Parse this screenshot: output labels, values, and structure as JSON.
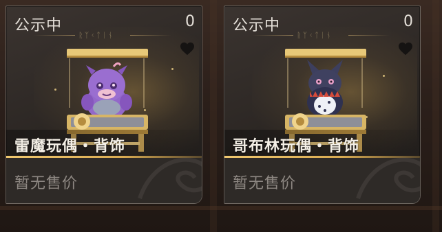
{
  "cards": [
    {
      "status": "公示中",
      "like_count": "0",
      "name": "雷魔玩偶・背饰",
      "price": "暂无售价",
      "figure_icon": "purple-demon-doll-icon",
      "figure_color": "#8d5fc7"
    },
    {
      "status": "公示中",
      "like_count": "0",
      "name": "哥布林玩偶・背饰",
      "price": "暂无售价",
      "figure_icon": "dark-goblin-doll-icon",
      "figure_color": "#3d3f5e"
    }
  ],
  "colors": {
    "accent_gold": "#e1b25a",
    "text_light": "#e4dfd8",
    "text_muted": "#8d8782"
  }
}
